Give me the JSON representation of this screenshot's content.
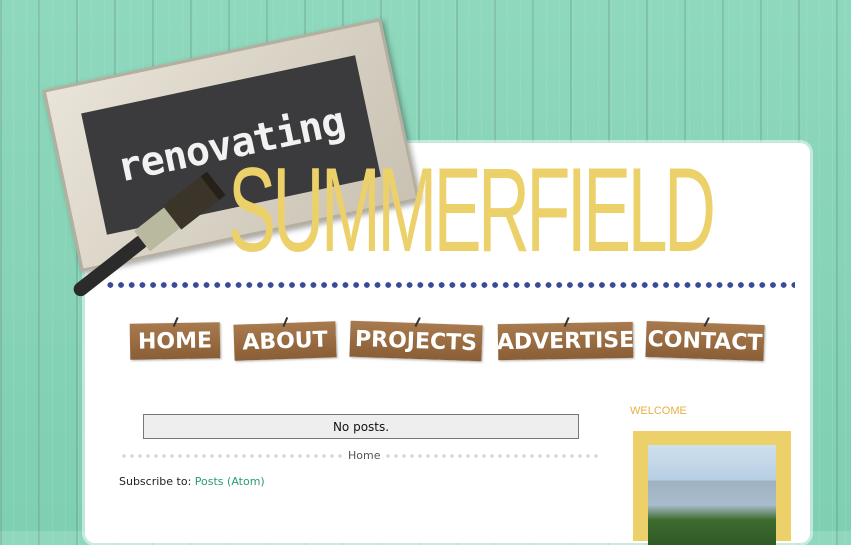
{
  "header": {
    "sign_text": "renovating",
    "title": "SUMMERFIELD"
  },
  "nav": {
    "items": [
      {
        "label": "HOME"
      },
      {
        "label": "ABOUT"
      },
      {
        "label": "PROJECTS"
      },
      {
        "label": "ADVERTISE"
      },
      {
        "label": "CONTACT"
      }
    ]
  },
  "main": {
    "no_posts": "No posts.",
    "home_link": "Home",
    "subscribe_label": "Subscribe to:",
    "subscribe_link": "Posts (Atom)"
  },
  "sidebar": {
    "welcome_title": "WELCOME"
  },
  "colors": {
    "background": "#8fd8be",
    "title": "#ecd16a",
    "dots": "#3a4a9a",
    "nav_wood": "#9a6c42",
    "link": "#2a9a7a",
    "welcome": "#e7b04a"
  }
}
